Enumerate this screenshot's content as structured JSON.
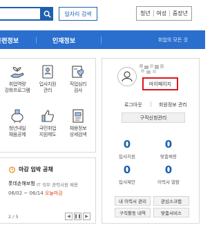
{
  "header": {
    "search_placeholder": "",
    "job_search_label": "일자리 검색",
    "filters": [
      "청년",
      "여성",
      "중장년"
    ]
  },
  "nav": {
    "items": [
      "훈련정보",
      "인재정보"
    ],
    "right_text": "취업의 모든 것"
  },
  "services": [
    {
      "line1": "취업역량",
      "line2": "강화프로그램",
      "icon": "hand-sprout-icon"
    },
    {
      "line1": "입사지원",
      "line2": "관리",
      "icon": "id-card-icon"
    },
    {
      "line1": "직업심리",
      "line2": "검사",
      "icon": "checklist-heart-icon"
    },
    {
      "line1": "청년내일",
      "line2": "채움공제",
      "icon": "piggy-bank-icon"
    },
    {
      "line1": "국민취업",
      "line2": "지원제도",
      "icon": "thumbs-up-icon"
    },
    {
      "line1": "채용정보",
      "line2": "상세검색",
      "icon": "document-search-icon"
    }
  ],
  "deadline": {
    "title": "마감 임박 공채",
    "company": "롯데손해보험",
    "job": "IT 직무 경력사원 채용",
    "date": "06/02 ~ 06/14",
    "status": "오늘마감",
    "page": "2 / 5"
  },
  "user": {
    "mypage_label": "마이페이지",
    "logout_label": "로그아웃",
    "member_info_label": "회원정보 관리",
    "resume_label": "구직신청관리",
    "stats": [
      {
        "value": "0",
        "label": "입사지원"
      },
      {
        "value": "0",
        "label": "맞춤채용"
      },
      {
        "value": "0",
        "label": "입사제안"
      },
      {
        "value": "0",
        "label": "이력서 열람"
      }
    ],
    "bottom_buttons": [
      "내 이력서 관리",
      "관심스크랩",
      "구직활동 내역",
      "맞춤서비스"
    ]
  },
  "colors": {
    "brand_blue": "#2a6fcd",
    "dark_blue": "#1f5fae",
    "highlight_red": "#e0141e",
    "deadline_orange": "#e0431c"
  }
}
